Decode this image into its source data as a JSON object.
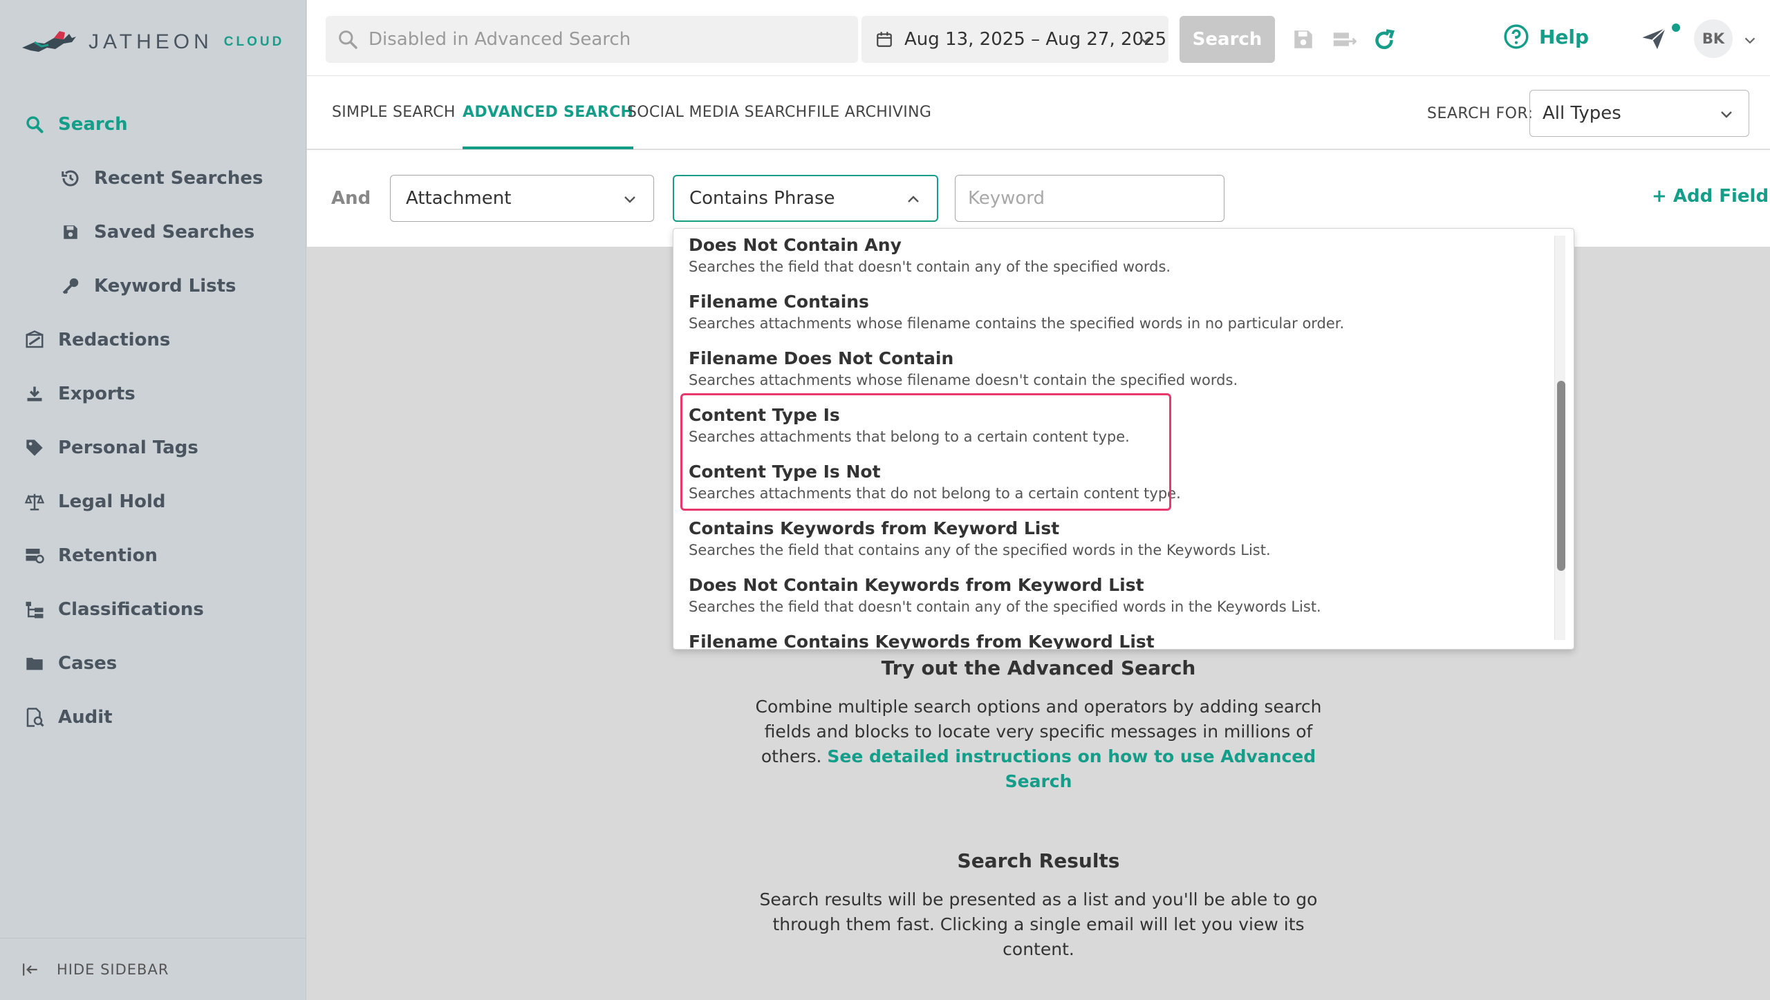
{
  "logo": {
    "text": "JATHEON",
    "cloud": "CLOUD"
  },
  "sidebar": {
    "items": [
      {
        "label": "Search",
        "icon": "search-icon"
      },
      {
        "label": "Recent Searches",
        "icon": "history-icon"
      },
      {
        "label": "Saved Searches",
        "icon": "save-icon"
      },
      {
        "label": "Keyword Lists",
        "icon": "key-icon"
      },
      {
        "label": "Redactions",
        "icon": "redaction-icon"
      },
      {
        "label": "Exports",
        "icon": "download-icon"
      },
      {
        "label": "Personal Tags",
        "icon": "tag-icon"
      },
      {
        "label": "Legal Hold",
        "icon": "scales-icon"
      },
      {
        "label": "Retention",
        "icon": "retention-icon"
      },
      {
        "label": "Classifications",
        "icon": "hierarchy-icon"
      },
      {
        "label": "Cases",
        "icon": "folder-icon"
      },
      {
        "label": "Audit",
        "icon": "audit-icon"
      }
    ],
    "footer": "HIDE SIDEBAR"
  },
  "topbar": {
    "search_placeholder": "Disabled in Advanced Search",
    "date_range": "Aug 13, 2025 – Aug 27, 2025",
    "search_button": "Search",
    "help": "Help",
    "avatar": "BK"
  },
  "tabs": {
    "items": [
      "SIMPLE SEARCH",
      "ADVANCED SEARCH",
      "SOCIAL MEDIA SEARCH",
      "FILE ARCHIVING"
    ],
    "active": "ADVANCED SEARCH",
    "search_for_label": "SEARCH FOR:",
    "search_for_value": "All Types"
  },
  "filter": {
    "operator": "And",
    "field": "Attachment",
    "condition": "Contains Phrase",
    "keyword_placeholder": "Keyword",
    "add_field": "+ Add Field"
  },
  "dropdown": {
    "items": [
      {
        "title": "Does Not Contain Any",
        "desc": "Searches the field that doesn't contain any of the specified words."
      },
      {
        "title": "Filename Contains",
        "desc": "Searches attachments whose filename contains the specified words in no particular order."
      },
      {
        "title": "Filename Does Not Contain",
        "desc": "Searches attachments whose filename doesn't contain the specified words."
      },
      {
        "title": "Content Type Is",
        "desc": "Searches attachments that belong to a certain content type."
      },
      {
        "title": "Content Type Is Not",
        "desc": "Searches attachments that do not belong to a certain content type."
      },
      {
        "title": "Contains Keywords from Keyword List",
        "desc": "Searches the field that contains any of the specified words in the Keywords List."
      },
      {
        "title": "Does Not Contain Keywords from Keyword List",
        "desc": "Searches the field that doesn't contain any of the specified words in the Keywords List."
      },
      {
        "title": "Filename Contains Keywords from Keyword List",
        "desc": ""
      }
    ]
  },
  "empty_state": {
    "try_title": "Try out the Advanced Search",
    "try_text": "Combine multiple search options and operators by adding search fields and blocks to locate very specific messages in millions of others.",
    "try_link": "See detailed instructions on how to use Advanced Search",
    "results_title": "Search Results",
    "results_text": "Search results will be presented as a list and you'll be able to go through them fast. Clicking a single email will let you view its content."
  },
  "colors": {
    "accent": "#149e8a",
    "highlight": "#e8386e",
    "sidebar_bg": "#cdd2d6"
  }
}
